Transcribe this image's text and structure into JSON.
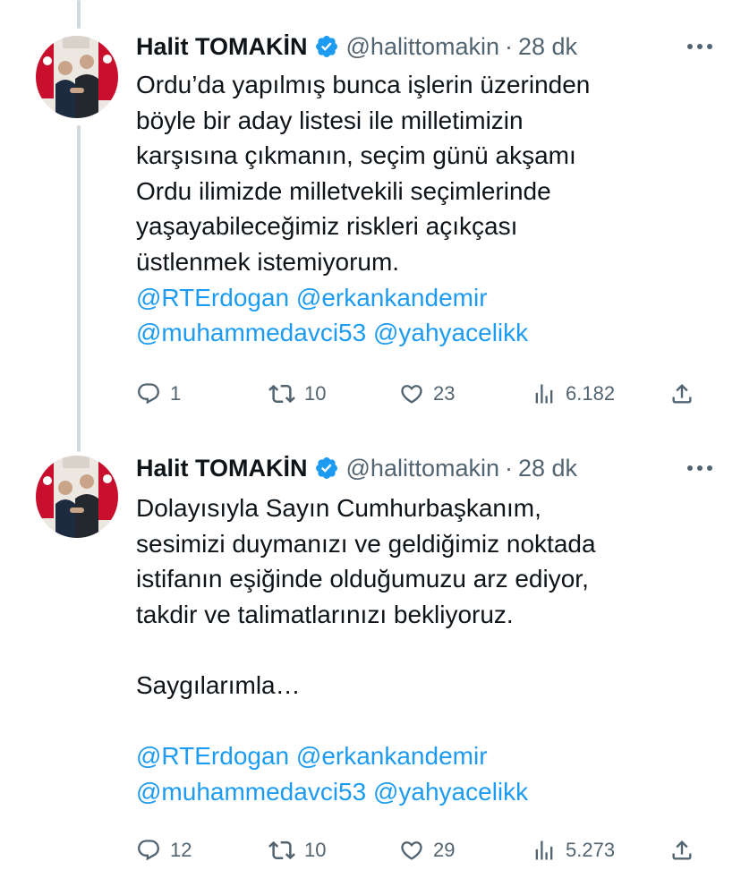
{
  "tweets": [
    {
      "author": {
        "name": "Halit TOMAKİN",
        "handle": "@halittomakin",
        "separator": "·",
        "time": "28 dk"
      },
      "text_lines": [
        "Ordu’da yapılmış bunca işlerin üzerinden",
        "böyle bir aday listesi ile milletimizin",
        "karşısına çıkmanın, seçim günü akşamı",
        "Ordu ilimizde milletvekili seçimlerinde",
        "yaşayabileceğimiz riskleri açıkçası",
        "üstlenmek istemiyorum."
      ],
      "mentions": [
        [
          "@RTErdogan",
          "@erkankandemir"
        ],
        [
          "@muhammedavci53",
          "@yahyacelikk"
        ]
      ],
      "stats": {
        "replies": "1",
        "retweets": "10",
        "likes": "23",
        "views": "6.182"
      }
    },
    {
      "author": {
        "name": "Halit TOMAKİN",
        "handle": "@halittomakin",
        "separator": "·",
        "time": "28 dk"
      },
      "text_lines": [
        "Dolayısıyla Sayın Cumhurbaşkanım,",
        "sesimizi duymanızı ve geldiğimiz noktada",
        "istifanın eşiğinde olduğumuzu arz ediyor,",
        "takdir ve talimatlarınızı bekliyoruz."
      ],
      "closing": "Saygılarımla…",
      "mentions": [
        [
          "@RTErdogan",
          "@erkankandemir"
        ],
        [
          "@muhammedavci53",
          "@yahyacelikk"
        ]
      ],
      "stats": {
        "replies": "12",
        "retweets": "10",
        "likes": "29",
        "views": "5.273"
      }
    }
  ],
  "icons": {
    "verified": "verified-badge-icon",
    "more": "more-horizontal-icon",
    "reply": "reply-bubble-icon",
    "retweet": "retweet-arrows-icon",
    "like": "heart-icon",
    "views": "views-bar-chart-icon",
    "share": "share-upload-icon"
  },
  "colors": {
    "text": "#0f1419",
    "secondary": "#536471",
    "link": "#1d9bf0",
    "verified": "#1d9bf0",
    "thread_line": "#cfd9de"
  }
}
